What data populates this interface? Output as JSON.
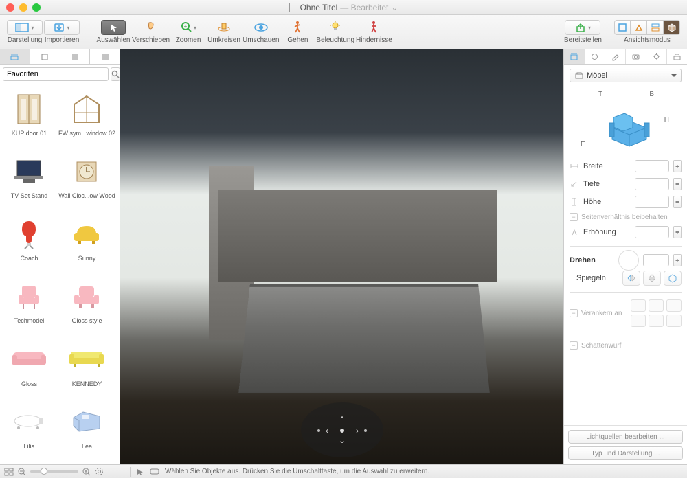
{
  "window": {
    "title": "Ohne Titel",
    "subtitle": "— Bearbeitet",
    "dropdown_arrow": "⌄"
  },
  "toolbar": {
    "darstellung": "Darstellung",
    "importieren": "Importieren",
    "auswaehlen": "Auswählen",
    "verschieben": "Verschieben",
    "zoomen": "Zoomen",
    "umkreisen": "Umkreisen",
    "umschauen": "Umschauen",
    "gehen": "Gehen",
    "beleuchtung": "Beleuchtung",
    "hindernisse": "Hindernisse",
    "bereitstellen": "Bereitstellen",
    "ansichtsmodus": "Ansichtsmodus"
  },
  "library": {
    "dropdown": "Favoriten",
    "items": [
      {
        "label": "KUP door 01"
      },
      {
        "label": "FW sym...window 02"
      },
      {
        "label": "TV Set Stand"
      },
      {
        "label": "Wall Cloc...ow Wood"
      },
      {
        "label": "Coach"
      },
      {
        "label": "Sunny"
      },
      {
        "label": "Techmodel"
      },
      {
        "label": "Gloss style"
      },
      {
        "label": "Gloss"
      },
      {
        "label": "KENNEDY"
      },
      {
        "label": "Lilia"
      },
      {
        "label": "Lea"
      }
    ]
  },
  "inspector": {
    "category": "Möbel",
    "dim_T": "T",
    "dim_B": "B",
    "dim_H": "H",
    "dim_E": "E",
    "breite": "Breite",
    "tiefe": "Tiefe",
    "hoehe": "Höhe",
    "keep_ratio": "Seitenverhältnis beibehalten",
    "erhoehung": "Erhöhung",
    "drehen": "Drehen",
    "spiegeln": "Spiegeln",
    "verankern": "Verankern an",
    "schattenwurf": "Schattenwurf",
    "lichtquellen": "Lichtquellen bearbeiten ...",
    "typ_darstellung": "Typ und Darstellung ..."
  },
  "statusbar": {
    "hint": "Wählen Sie Objekte aus. Drücken Sie die Umschalttaste, um die Auswahl zu erweitern."
  },
  "colors": {
    "accent": "#3b99e0"
  }
}
